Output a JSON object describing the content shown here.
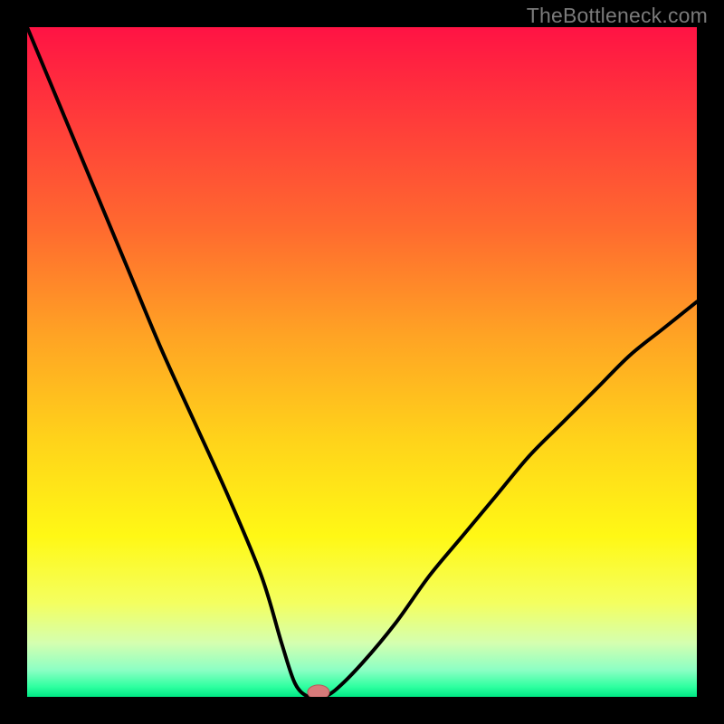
{
  "watermark": "TheBottleneck.com",
  "chart_data": {
    "type": "line",
    "title": "",
    "xlabel": "",
    "ylabel": "",
    "xlim": [
      0,
      100
    ],
    "ylim": [
      0,
      100
    ],
    "x": [
      0,
      5,
      10,
      15,
      20,
      25,
      30,
      35,
      38,
      40,
      42,
      44,
      46,
      50,
      55,
      60,
      65,
      70,
      75,
      80,
      85,
      90,
      95,
      100
    ],
    "values": [
      100,
      88,
      76,
      64,
      52,
      41,
      30,
      18,
      8,
      2,
      0,
      0,
      1,
      5,
      11,
      18,
      24,
      30,
      36,
      41,
      46,
      51,
      55,
      59
    ],
    "marker": {
      "x": 43.5,
      "y": 0.7
    },
    "gradient_stops": [
      {
        "offset": 0.0,
        "color": "#ff1344"
      },
      {
        "offset": 0.14,
        "color": "#ff3c3a"
      },
      {
        "offset": 0.3,
        "color": "#ff6a2f"
      },
      {
        "offset": 0.46,
        "color": "#ffa324"
      },
      {
        "offset": 0.62,
        "color": "#ffd41a"
      },
      {
        "offset": 0.76,
        "color": "#fff815"
      },
      {
        "offset": 0.86,
        "color": "#f4ff60"
      },
      {
        "offset": 0.92,
        "color": "#d4ffb0"
      },
      {
        "offset": 0.96,
        "color": "#8cffc4"
      },
      {
        "offset": 0.985,
        "color": "#2effa0"
      },
      {
        "offset": 1.0,
        "color": "#00e884"
      }
    ],
    "colors": {
      "curve": "#000000",
      "marker_fill": "#d77a7a",
      "marker_stroke": "#b55a5a",
      "frame": "#000000"
    }
  }
}
